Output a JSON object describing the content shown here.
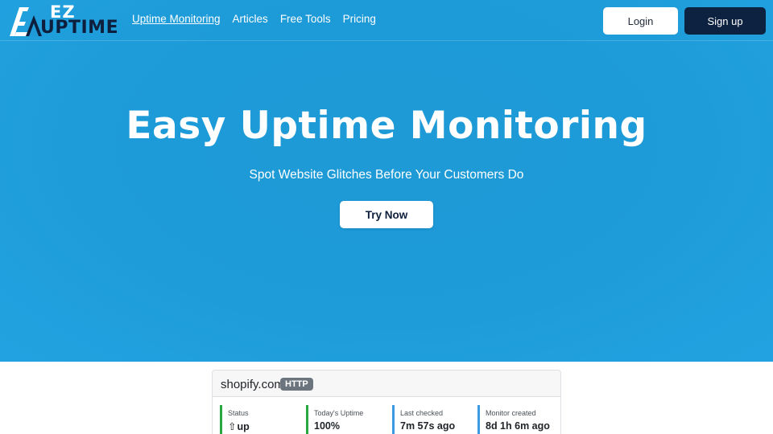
{
  "header": {
    "logo": {
      "top": "EZ",
      "bottom": "UPTIME"
    },
    "nav": [
      {
        "label": "Uptime Monitoring",
        "active": true
      },
      {
        "label": "Articles"
      },
      {
        "label": "Free Tools"
      },
      {
        "label": "Pricing"
      }
    ],
    "login_label": "Login",
    "signup_label": "Sign up"
  },
  "hero": {
    "title": "Easy Uptime Monitoring",
    "subtitle": "Spot Website Glitches Before Your Customers Do",
    "cta_label": "Try Now"
  },
  "monitor_card": {
    "domain": "shopify.com",
    "protocol": "HTTP",
    "stats": [
      {
        "label": "Status",
        "value": "up",
        "icon": "arrow-up-icon",
        "color": "#28a745"
      },
      {
        "label": "Today's Uptime",
        "value": "100%",
        "color": "#28a745"
      },
      {
        "label": "Last checked",
        "value": "7m 57s ago",
        "color": "#3b9ae1"
      },
      {
        "label": "Monitor created",
        "value": "8d 1h 6m ago",
        "color": "#3b9ae1"
      }
    ]
  },
  "colors": {
    "hero_blue": "#1e9ad6",
    "navy": "#0d2240",
    "status_green": "#28a745",
    "info_blue": "#3b9ae1"
  }
}
